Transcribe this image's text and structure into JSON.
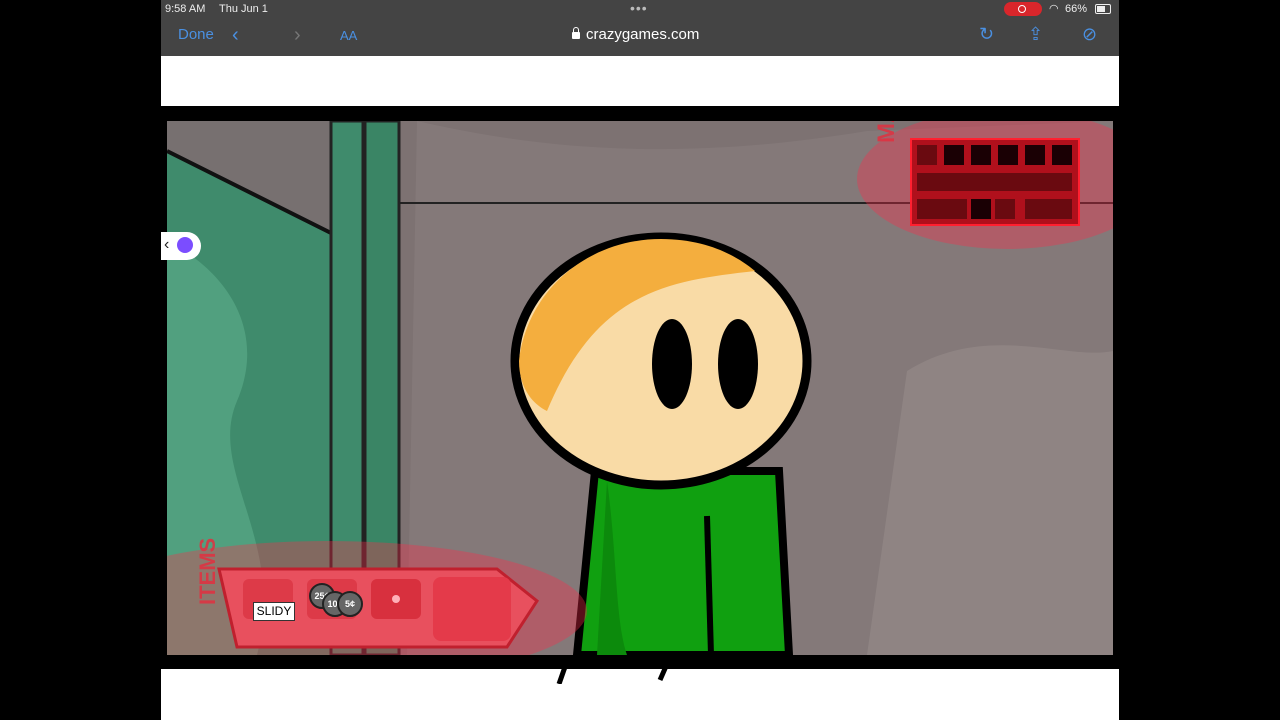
{
  "status_bar": {
    "time": "9:58 AM",
    "date": "Thu Jun 1",
    "battery": "66%"
  },
  "browser": {
    "done_label": "Done",
    "aa_label": "AA",
    "url": "crazygames.com"
  },
  "game": {
    "map_label": "MAP",
    "items_label": "ITEMS",
    "inventory": {
      "slidy_label": "SLIDY",
      "coins": [
        "25¢",
        "10¢",
        "5¢"
      ]
    }
  },
  "colors": {
    "hud_red": "#e23040",
    "wall": "#7d7272",
    "green_panel": "#3f8b6c",
    "shirt": "#10a010",
    "skin": "#f9dba6",
    "hair": "#f4ae3e"
  }
}
